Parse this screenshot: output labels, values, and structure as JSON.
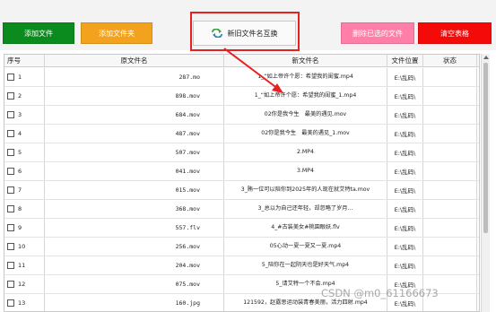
{
  "toolbar": {
    "add_file": "添加文件",
    "add_folder": "添加文件夹",
    "rename_swap": "新旧文件名互换",
    "delete_selected": "删除已选的文件",
    "clear_table": "清空表格"
  },
  "colors": {
    "add_file": "#0b8a1e",
    "add_folder": "#f2a21c",
    "delete_selected": "#ff7fa8",
    "clear_table": "#f50a0a",
    "highlight": "#e82020"
  },
  "icons": {
    "rename_swap": "swap-arrows-icon"
  },
  "table": {
    "headers": [
      "序号",
      "原文件名",
      "新文件名",
      "文件位置",
      "状态"
    ],
    "rows": [
      {
        "no": "1",
        "orig": "287.mo",
        "new": "1_“如上帝许个愿：希望我的闺蜜.mp4",
        "loc": "E:\\乱码\\",
        "status": ""
      },
      {
        "no": "2",
        "orig": "898.mov",
        "new": "1_“如上帝许个愿：希望我的闺蜜_1.mp4",
        "loc": "E:\\乱码\\",
        "status": ""
      },
      {
        "no": "3",
        "orig": "684.mov",
        "new": "02你是我今生　最美的遇见.mov",
        "loc": "E:\\乱码\\",
        "status": ""
      },
      {
        "no": "4",
        "orig": "487.mov",
        "new": "02你是我今生　最美的遇见_1.mov",
        "loc": "E:\\乱码\\",
        "status": ""
      },
      {
        "no": "5",
        "orig": "507.mov",
        "new": "2.MP4",
        "loc": "E:\\乱码\\",
        "status": ""
      },
      {
        "no": "6",
        "orig": "041.mov",
        "new": "3.MP4",
        "loc": "E:\\乱码\\",
        "status": ""
      },
      {
        "no": "7",
        "orig": "015.mov",
        "new": "3_贿一位可以陪你到2025年的人现在就艾特ta.mov",
        "loc": "E:\\乱码\\",
        "status": ""
      },
      {
        "no": "8",
        "orig": "368.mov",
        "new": "3_总以为自己还年轻，却忽略了岁月...",
        "loc": "E:\\乱码\\",
        "status": ""
      },
      {
        "no": "9",
        "orig": "557.flv",
        "new": "4_#古装美女#桃園眼妖.flv",
        "loc": "E:\\乱码\\",
        "status": ""
      },
      {
        "no": "10",
        "orig": "256.mov",
        "new": "05心动一夏一夏又一夏.mp4",
        "loc": "E:\\乱码\\",
        "status": ""
      },
      {
        "no": "11",
        "orig": "204.mov",
        "new": "5_陪你在一起阴天也是好天气.mp4",
        "loc": "E:\\乱码\\",
        "status": ""
      },
      {
        "no": "12",
        "orig": "075.mov",
        "new": "5_请艾特一个不会.mp4",
        "loc": "E:\\乱码\\",
        "status": ""
      },
      {
        "no": "13",
        "orig": "160.jpg",
        "new": "121592，赵露思运动装青春美丽，活力四射.mp4",
        "loc": "E:\\乱码\\",
        "status": ""
      }
    ]
  },
  "watermark": "CSDN @m0_61166673"
}
